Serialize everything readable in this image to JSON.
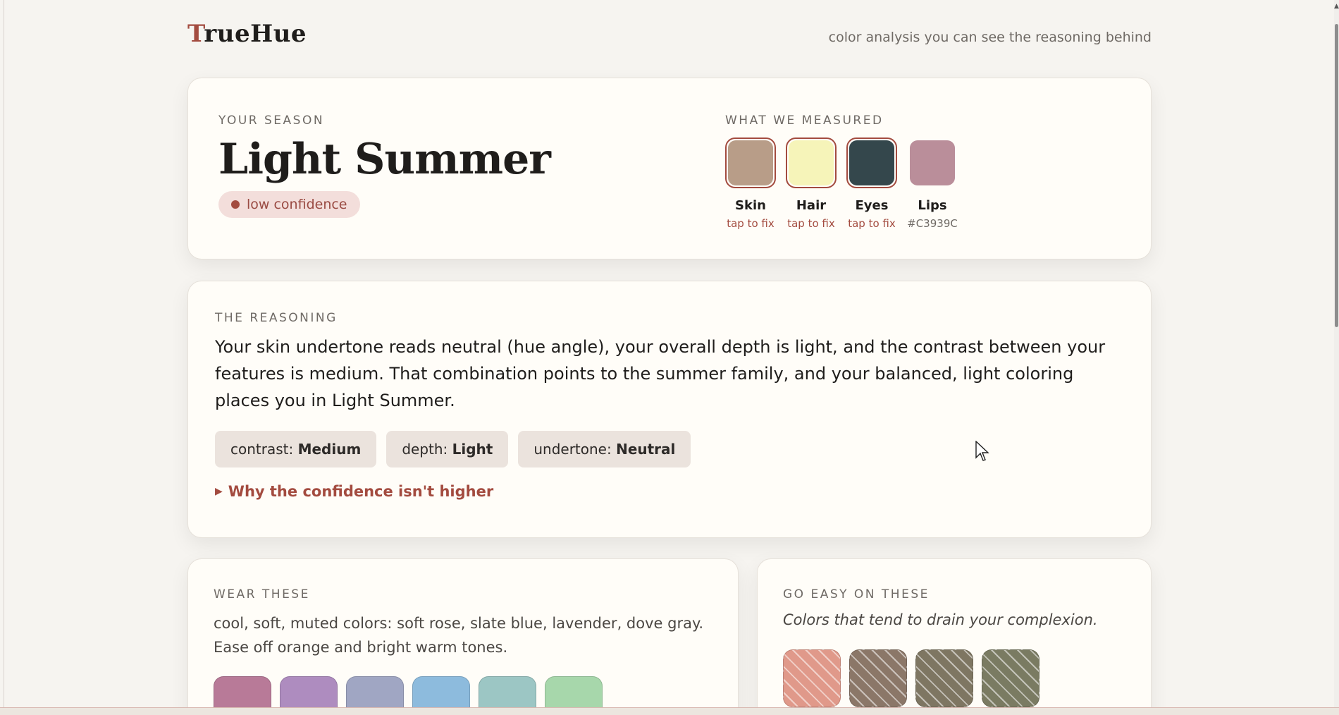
{
  "header": {
    "brand_first": "T",
    "brand_rest": "rueHue",
    "tagline": "color analysis you can see the reasoning behind"
  },
  "season": {
    "label": "YOUR SEASON",
    "title": "Light Summer",
    "confidence": "low confidence"
  },
  "measured": {
    "label": "WHAT WE MEASURED",
    "items": [
      {
        "name": "Skin",
        "note": "tap to fix",
        "color": "#B89D88",
        "flagged": true
      },
      {
        "name": "Hair",
        "note": "tap to fix",
        "color": "#F6F4B9",
        "flagged": true
      },
      {
        "name": "Eyes",
        "note": "tap to fix",
        "color": "#34474C",
        "flagged": true
      },
      {
        "name": "Lips",
        "note": "#C3939C",
        "color": "#BA8E9A",
        "flagged": false
      }
    ]
  },
  "reasoning": {
    "label": "THE REASONING",
    "text": "Your skin undertone reads neutral (hue angle), your overall depth is light, and the contrast between your features is medium. That combination points to the summer family, and your balanced, light coloring places you in Light Summer.",
    "chips": [
      {
        "key": "contrast:",
        "value": "Medium"
      },
      {
        "key": "depth:",
        "value": "Light"
      },
      {
        "key": "undertone:",
        "value": "Neutral"
      }
    ],
    "why_label": "Why the confidence isn't higher"
  },
  "wear": {
    "label": "WEAR THESE",
    "text": "cool, soft, muted colors: soft rose, slate blue, lavender, dove gray. Ease off orange and bright warm tones.",
    "colors": [
      "#B87A98",
      "#AE8CBF",
      "#A0A6C3",
      "#8DBBDD",
      "#9CC6C4",
      "#A7D7AB"
    ]
  },
  "avoid": {
    "label": "GO EASY ON THESE",
    "text": "Colors that tend to drain your complexion.",
    "colors": [
      "#E0998A",
      "#8B7768",
      "#7E7662",
      "#7A7B62"
    ]
  }
}
